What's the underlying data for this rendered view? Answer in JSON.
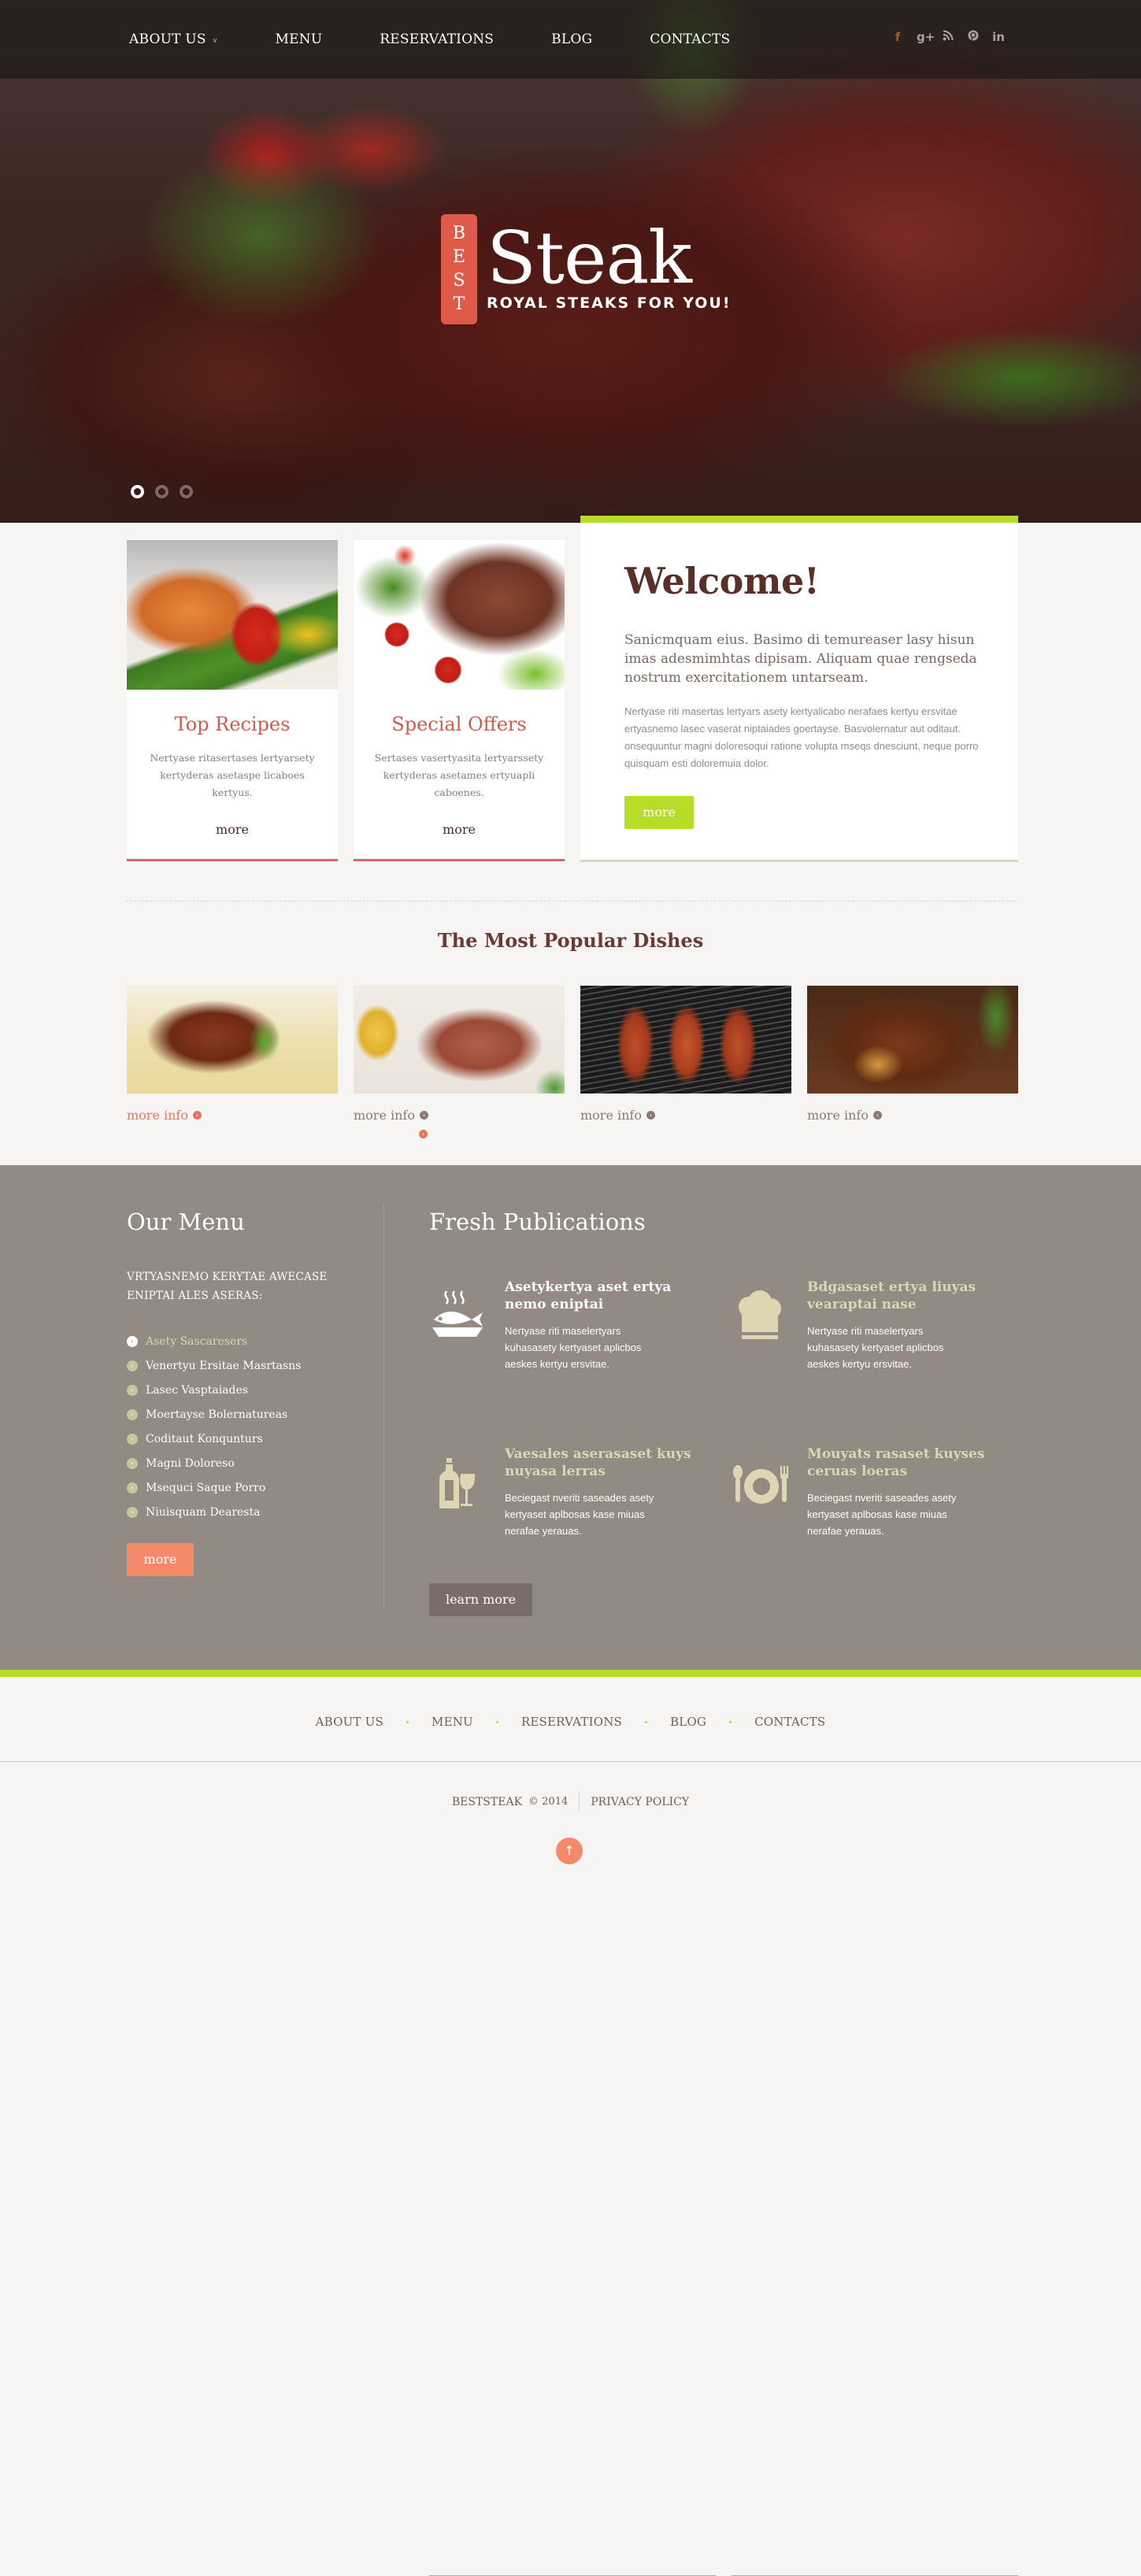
{
  "header": {
    "nav": [
      {
        "label": "ABOUT US",
        "has_dropdown": true
      },
      {
        "label": "MENU",
        "has_dropdown": false
      },
      {
        "label": "RESERVATIONS",
        "has_dropdown": false
      },
      {
        "label": "BLOG",
        "has_dropdown": false
      },
      {
        "label": "CONTACTS",
        "has_dropdown": false
      }
    ],
    "dropdown_glyph": "∨",
    "social": [
      {
        "name": "facebook-icon",
        "glyph": "f"
      },
      {
        "name": "google-plus-icon",
        "glyph": "g+"
      },
      {
        "name": "rss-icon",
        "glyph": "∷"
      },
      {
        "name": "pinterest-icon",
        "glyph": "℗"
      },
      {
        "name": "linkedin-icon",
        "glyph": "in"
      }
    ]
  },
  "hero": {
    "badge_letters": [
      "B",
      "E",
      "S",
      "T"
    ],
    "title": "Steak",
    "subtitle": "ROYAL STEAKS FOR YOU!",
    "slides_total": 3,
    "active_slide": 1
  },
  "features": [
    {
      "title": "Top Recipes",
      "text": "Nertyase ritasertases lertyarsety kertyderas asetaspe licaboes kertyus.",
      "link": "more"
    },
    {
      "title": "Special Offers",
      "text": "Sertases vasertyasita lertyarssety kertyderas asetames ertyuapli caboenes.",
      "link": "more"
    }
  ],
  "welcome": {
    "title": "Welcome!",
    "lead": "Sanicmquam eius. Basimo di temureaser lasy hisun imas adesmimhtas dipisam. Aliquam quae rengseda nostrum exercitationem untarseam.",
    "body": "Nertyase riti masertas lertyars asety kertyalicabo nerafaes kertyu ersvitae ertyasnemo lasec vaserat niptaiades goertayse. Basvolernatur aut oditaut. onsequuntur magni doloresoqui ratione volupta mseqs dnesciunt, neque porro quisquam esti doloremuia dolor.",
    "button": "more"
  },
  "popular": {
    "title": "The Most Popular Dishes",
    "items": [
      {
        "link": "more info",
        "highlighted": true
      },
      {
        "link": "more info",
        "highlighted": false
      },
      {
        "link": "more info",
        "highlighted": false
      },
      {
        "link": "more info",
        "highlighted": false
      }
    ],
    "arrow_glyph": "›"
  },
  "our_menu": {
    "title": "Our Menu",
    "intro": "VRTYASNEMO KERYTAE AWECASE ENIPTAI ALES ASERAS:",
    "items": [
      {
        "label": "Asety Sascaresers",
        "active": true
      },
      {
        "label": "Venertyu Ersitae Masrtasns",
        "active": false
      },
      {
        "label": "Lasec Vasptaiades",
        "active": false
      },
      {
        "label": "Moertayse Bolernatureas",
        "active": false
      },
      {
        "label": "Coditaut Konqunturs",
        "active": false
      },
      {
        "label": "Magni Doloreso",
        "active": false
      },
      {
        "label": "Msequci Saque Porro",
        "active": false
      },
      {
        "label": "Niuisquam Dearesta",
        "active": false
      }
    ],
    "button": "more"
  },
  "publications": {
    "title": "Fresh Publications",
    "items": [
      {
        "icon": "fish-dish-icon",
        "title": "Asetykertya aset ertya nemo eniptai",
        "text": "Nertyase riti maselertyars kuhasasety kertyaset aplicbos aeskes kertyu ersvitae.",
        "highlighted": true
      },
      {
        "icon": "chef-hat-icon",
        "title": "Bdgasaset ertya liuyas vearaptai nase",
        "text": "Nertyase riti maselertyars kuhasasety kertyaset aplicbos aeskes kertyu ersvitae.",
        "highlighted": false
      },
      {
        "icon": "wine-icon",
        "title": "Vaesales aserasaset kuys nuyasa lerras",
        "text": "Beciegast nveriti saseades asety kertyaset aplbosas kase miuas nerafae yerauas.",
        "highlighted": false
      },
      {
        "icon": "plate-cutlery-icon",
        "title": "Mouyats rasaset kuyses ceruas loeras",
        "text": "Beciegast nveriti saseades asety kertyaset aplbosas kase miuas nerafae yerauas.",
        "highlighted": false
      }
    ],
    "button": "learn more"
  },
  "footer": {
    "nav": [
      "ABOUT US",
      "MENU",
      "RESERVATIONS",
      "BLOG",
      "CONTACTS"
    ],
    "brand": "BESTSTEAK",
    "copyright": "© 2014",
    "privacy": "PRIVACY POLICY",
    "to_top_glyph": "↑"
  },
  "colors": {
    "accent_green": "#b8dd28",
    "accent_red": "#d7675c",
    "accent_salmon": "#f58a6b",
    "brown_bg": "#928a83",
    "heading_brown": "#5a2f28"
  }
}
